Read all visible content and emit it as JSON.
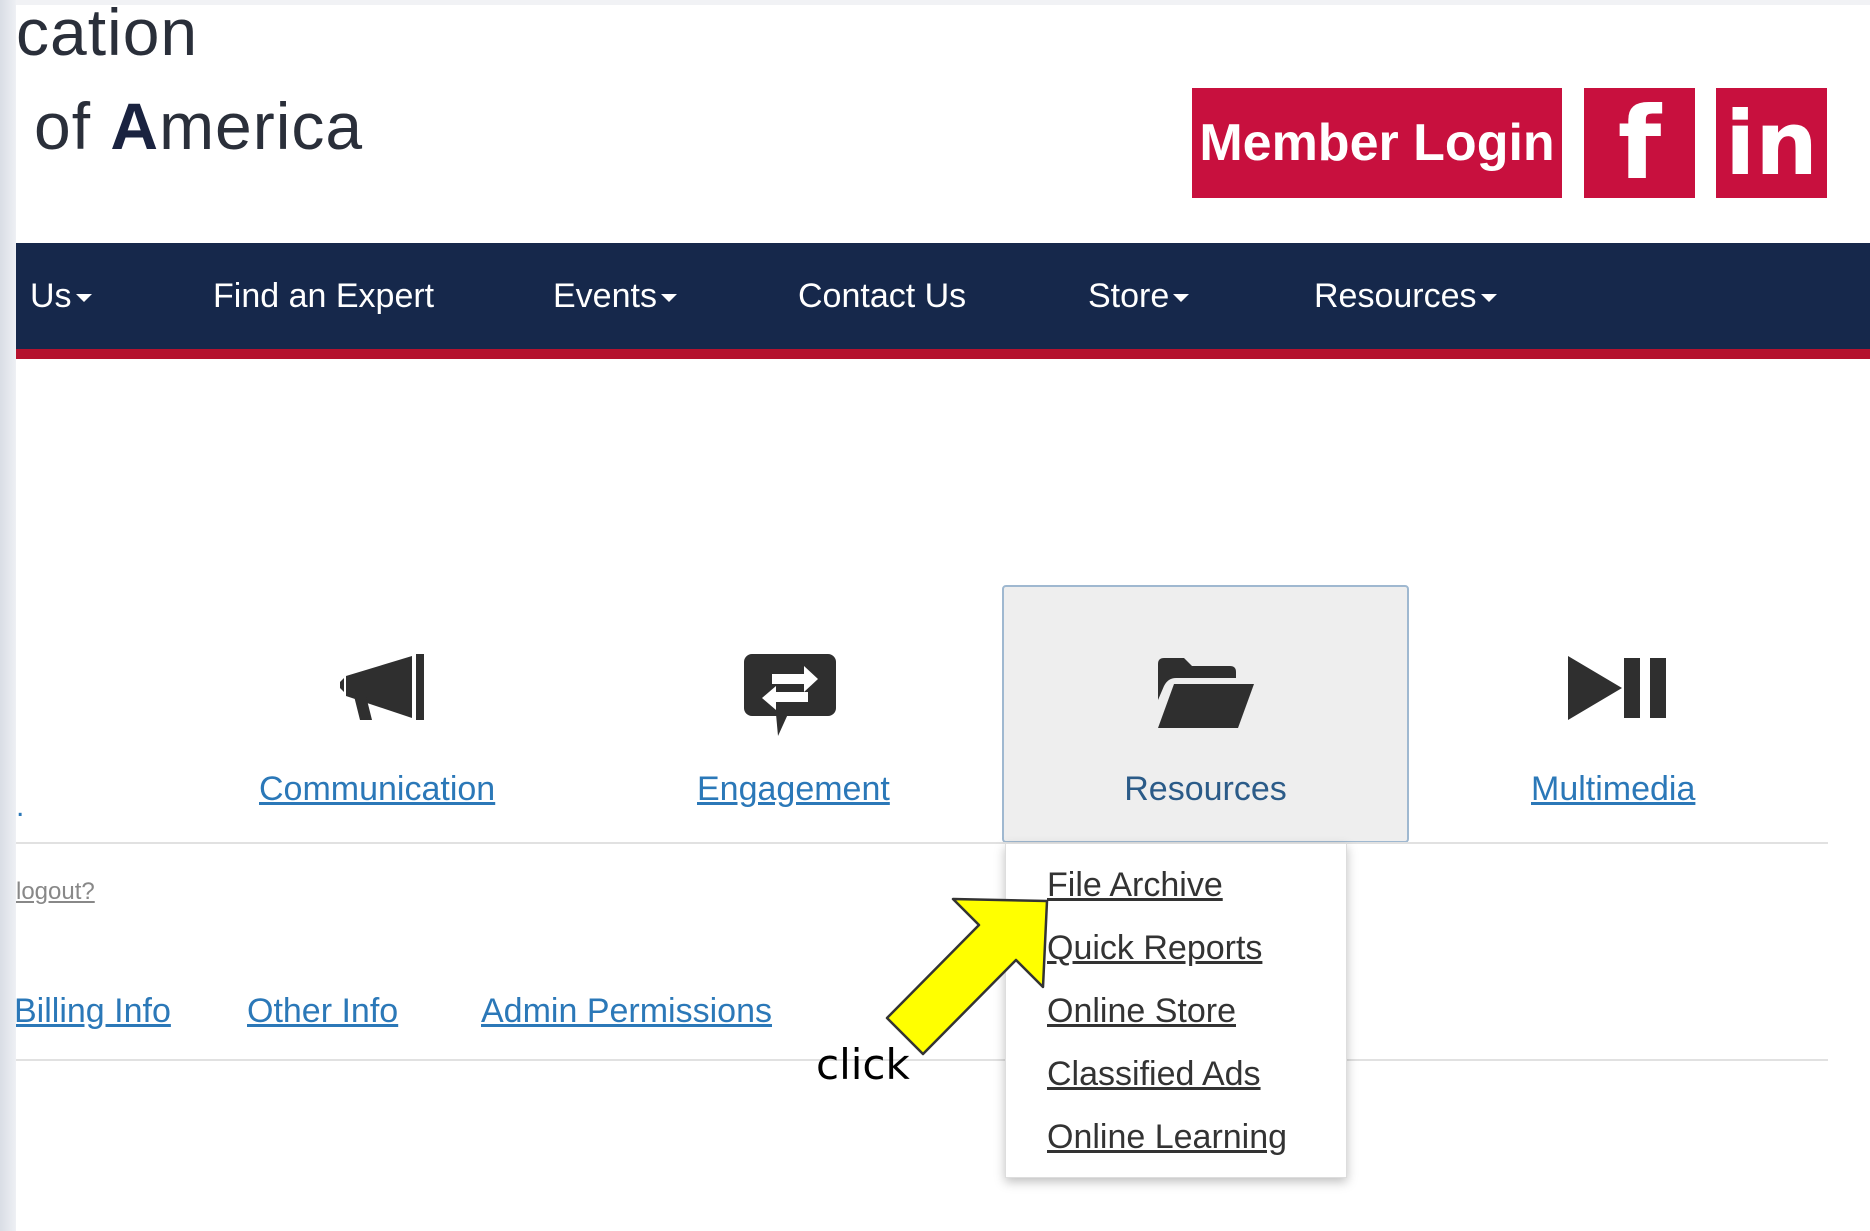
{
  "logo": {
    "line1": "cation",
    "line2_prefix": "of ",
    "line2_bold": "A",
    "line2_rest": "merica"
  },
  "header": {
    "member_login": "Member Login",
    "facebook_glyph": "f",
    "linkedin_glyph": "in",
    "accent_color": "#c8103e"
  },
  "nav": {
    "background_color": "#16284b",
    "items": [
      {
        "label": "Us",
        "has_caret": true
      },
      {
        "label": "Find an Expert",
        "has_caret": false
      },
      {
        "label": "Events",
        "has_caret": true
      },
      {
        "label": "Contact Us",
        "has_caret": false
      },
      {
        "label": "Store",
        "has_caret": true
      },
      {
        "label": "Resources",
        "has_caret": true
      }
    ]
  },
  "tiles": {
    "items": [
      {
        "label": "Communication",
        "icon": "bullhorn-icon"
      },
      {
        "label": "Engagement",
        "icon": "exchange-chat-icon"
      },
      {
        "label": "Resources",
        "icon": "folder-open-icon",
        "active": true
      },
      {
        "label": "Multimedia",
        "icon": "play-pause-icon"
      }
    ]
  },
  "account": {
    "logout": "logout?",
    "links": [
      "Billing Info",
      "Other Info",
      "Admin Permissions"
    ]
  },
  "dropdown": {
    "items": [
      "File Archive",
      "Quick Reports",
      "Online Store",
      "Classified Ads",
      "Online Learning"
    ]
  },
  "annotation": {
    "text": "click",
    "arrow_color": "#ffff00"
  }
}
